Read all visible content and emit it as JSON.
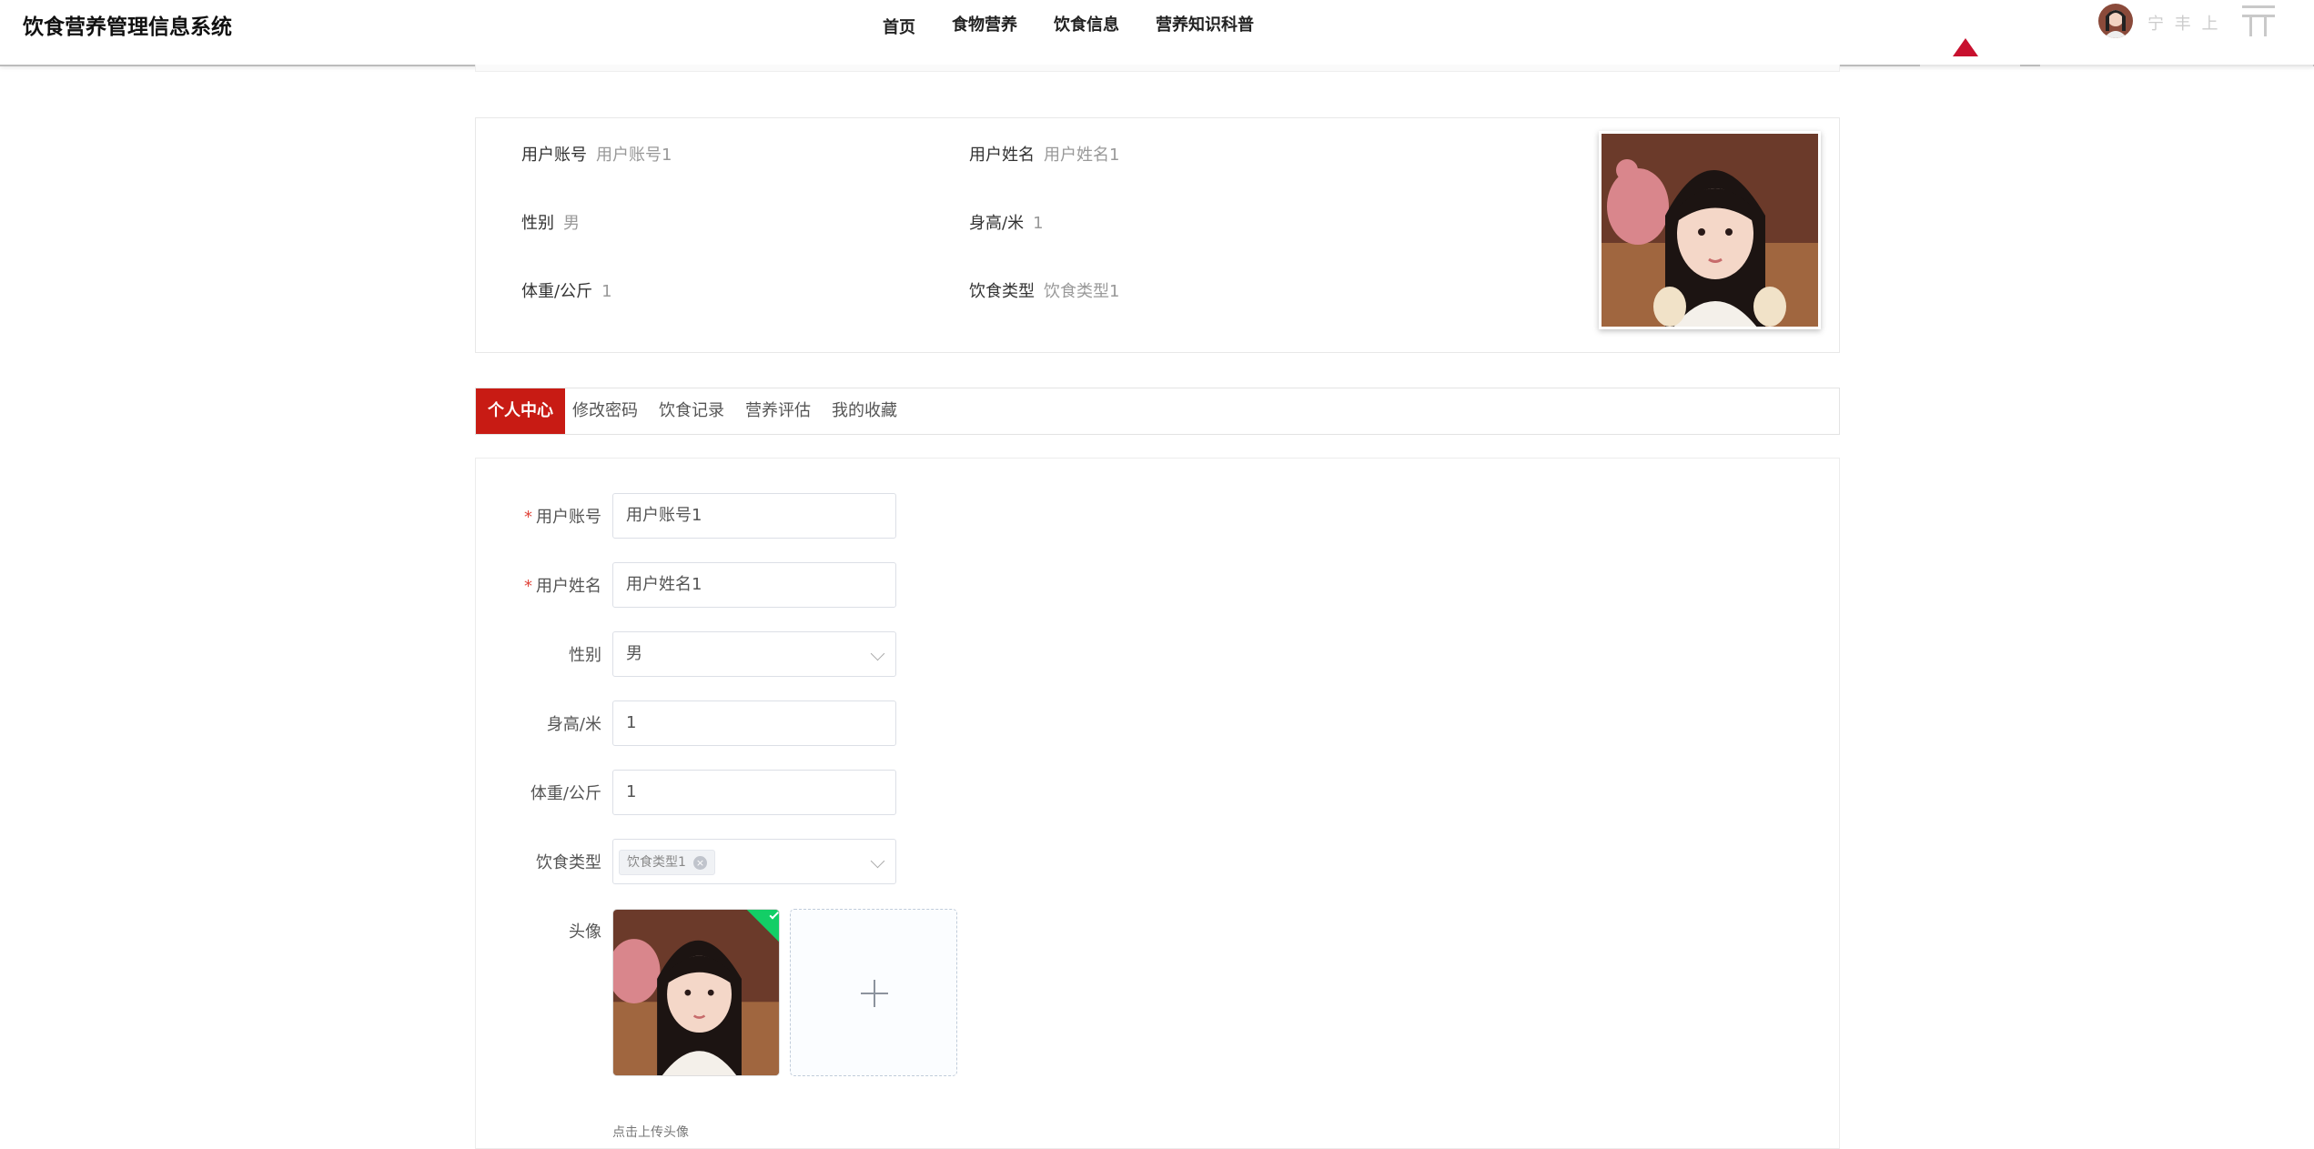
{
  "header": {
    "brand": "饮食营养管理信息系统",
    "nav": [
      "首页",
      "食物营养",
      "饮食信息",
      "营养知识科普"
    ],
    "user_name": "宁 丰 上",
    "accent_color": "#c8102e"
  },
  "profile": {
    "fields": [
      {
        "label": "用户账号",
        "value": "用户账号1"
      },
      {
        "label": "用户姓名",
        "value": "用户姓名1"
      },
      {
        "label": "性别",
        "value": "男"
      },
      {
        "label": "身高/米",
        "value": "1"
      },
      {
        "label": "体重/公斤",
        "value": "1"
      },
      {
        "label": "饮食类型",
        "value": "饮食类型1"
      }
    ],
    "photo_icon": "avatar-photo"
  },
  "tabs": [
    "个人中心",
    "修改密码",
    "饮食记录",
    "营养评估",
    "我的收藏"
  ],
  "form": {
    "account_label": "用户账号",
    "account_value": "用户账号1",
    "name_label": "用户姓名",
    "name_value": "用户姓名1",
    "gender_label": "性别",
    "gender_value": "男",
    "height_label": "身高/米",
    "height_value": "1",
    "weight_label": "体重/公斤",
    "weight_value": "1",
    "diet_label": "饮食类型",
    "diet_tag": "饮食类型1",
    "avatar_label": "头像",
    "upload_tip": "点击上传头像",
    "required_mark": "*"
  }
}
